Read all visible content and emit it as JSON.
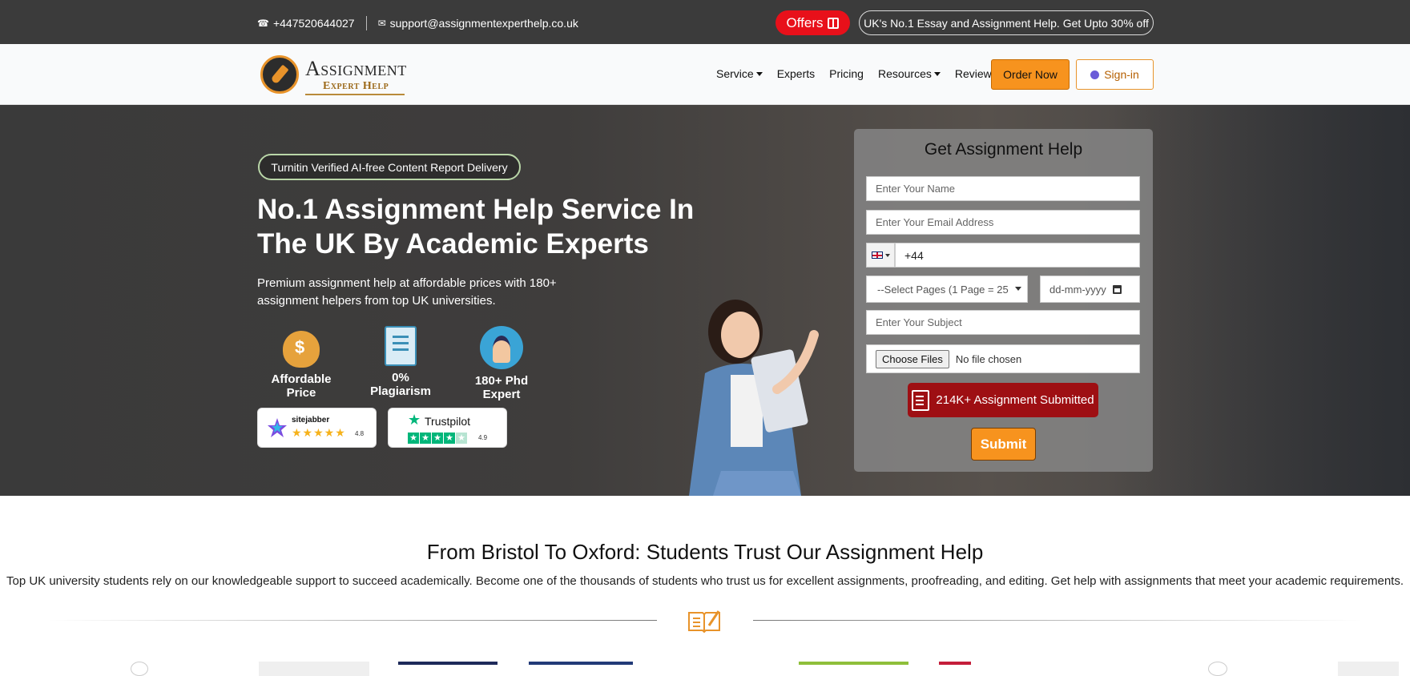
{
  "topbar": {
    "phone": "+447520644027",
    "email": "support@assignmentexperthelp.co.uk",
    "offers_label": "Offers",
    "promo_text": "UK's No.1 Essay and Assignment Help. Get Upto 30% off"
  },
  "logo": {
    "line1": "Assignment",
    "line2": "Expert Help"
  },
  "nav": {
    "items": [
      {
        "label": "Service",
        "dropdown": true
      },
      {
        "label": "Experts",
        "dropdown": false
      },
      {
        "label": "Pricing",
        "dropdown": false
      },
      {
        "label": "Resources",
        "dropdown": true
      },
      {
        "label": "Review",
        "dropdown": false
      }
    ],
    "order_label": "Order Now",
    "signin_label": "Sign-in"
  },
  "hero": {
    "badge": "Turnitin Verified AI-free Content Report Delivery",
    "title": "No.1 Assignment Help Service In The UK By Academic Experts",
    "subtitle": "Premium assignment help at affordable prices with 180+ assignment helpers from top UK universities.",
    "features": [
      {
        "label": "Affordable Price",
        "icon": "money-bag-icon"
      },
      {
        "label": "0% Plagiarism",
        "icon": "document-check-icon"
      },
      {
        "label": "180+ Phd Expert",
        "icon": "graduate-icon"
      }
    ],
    "ratings": [
      {
        "name": "sitejabber",
        "stars": "★★★★★",
        "score": "4.8"
      },
      {
        "name": "Trustpilot",
        "stars": "★★★★★",
        "score": "4.9"
      }
    ]
  },
  "form": {
    "title": "Get Assignment Help",
    "name_placeholder": "Enter Your Name",
    "email_placeholder": "Enter Your Email Address",
    "phone_value": "+44",
    "pages_select": "--Select Pages (1 Page = 25",
    "date_placeholder": "dd-mm-yyyy",
    "subject_placeholder": "Enter Your Subject",
    "choose_files": "Choose Files",
    "no_file": "No file chosen",
    "submitted_text": "214K+ Assignment Submitted",
    "submit_label": "Submit"
  },
  "trust": {
    "title": "From Bristol To Oxford: Students Trust Our Assignment Help",
    "subtitle": "Top UK university students rely on our knowledgeable support to succeed academically. Become one of the thousands of students who trust us for excellent assignments, proofreading, and editing. Get help with assignments that meet your academic requirements."
  },
  "colors": {
    "accent": "#f7931e",
    "offers_red": "#e8101a",
    "submitted_red": "#9e0f13",
    "topbar": "#3b3b3b"
  }
}
